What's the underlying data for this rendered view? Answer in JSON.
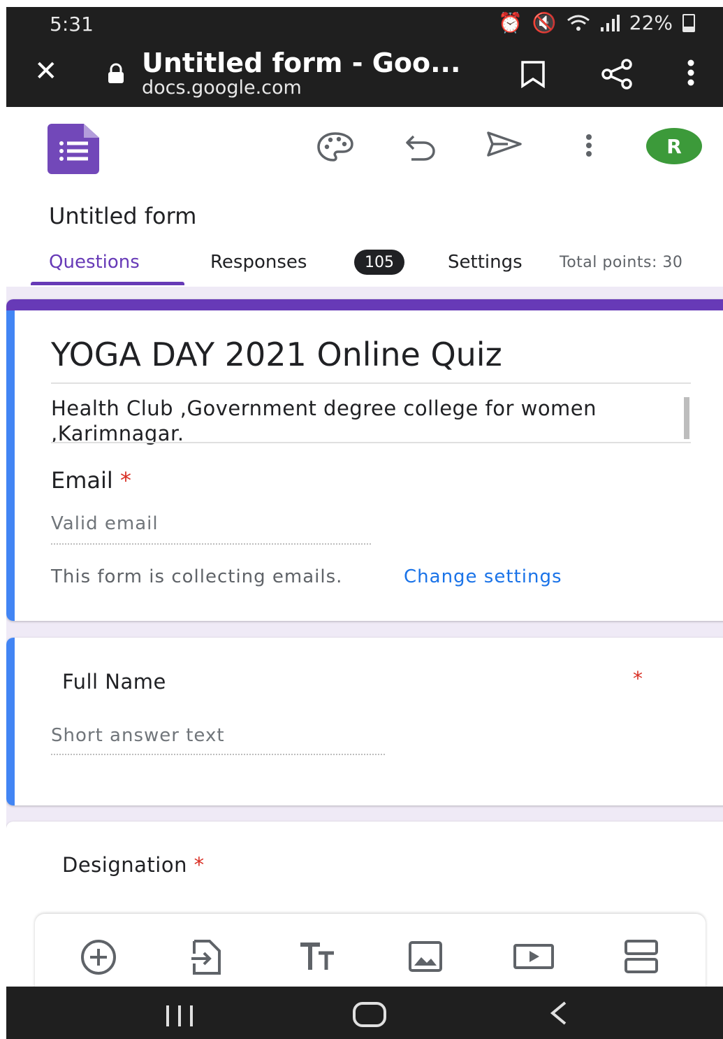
{
  "status_bar": {
    "time": "5:31",
    "battery": "22%"
  },
  "browser": {
    "tab_title": "Untitled form - Goo...",
    "url": "docs.google.com"
  },
  "header": {
    "avatar_initial": "R"
  },
  "form": {
    "name": "Untitled form",
    "tabs": {
      "questions": "Questions",
      "responses": "Responses",
      "responses_count": "105",
      "settings": "Settings"
    },
    "total_points": "Total points: 30",
    "title": "YOGA DAY 2021 Online Quiz",
    "description": "Health Club ,Government degree college for women ,Karimnagar.",
    "email": {
      "label": "Email",
      "required_mark": "*",
      "placeholder": "Valid email",
      "notice": "This form is collecting emails.",
      "change_link": "Change settings"
    },
    "questions": [
      {
        "label": "Full Name",
        "required_mark": "*",
        "placeholder": "Short answer text"
      },
      {
        "label": "Designation",
        "required_mark": "*"
      }
    ]
  },
  "colors": {
    "accent": "#673ab7",
    "focus": "#4285f4",
    "link": "#1a73e8",
    "required": "#d93025",
    "avatar": "#3c9a3a"
  }
}
